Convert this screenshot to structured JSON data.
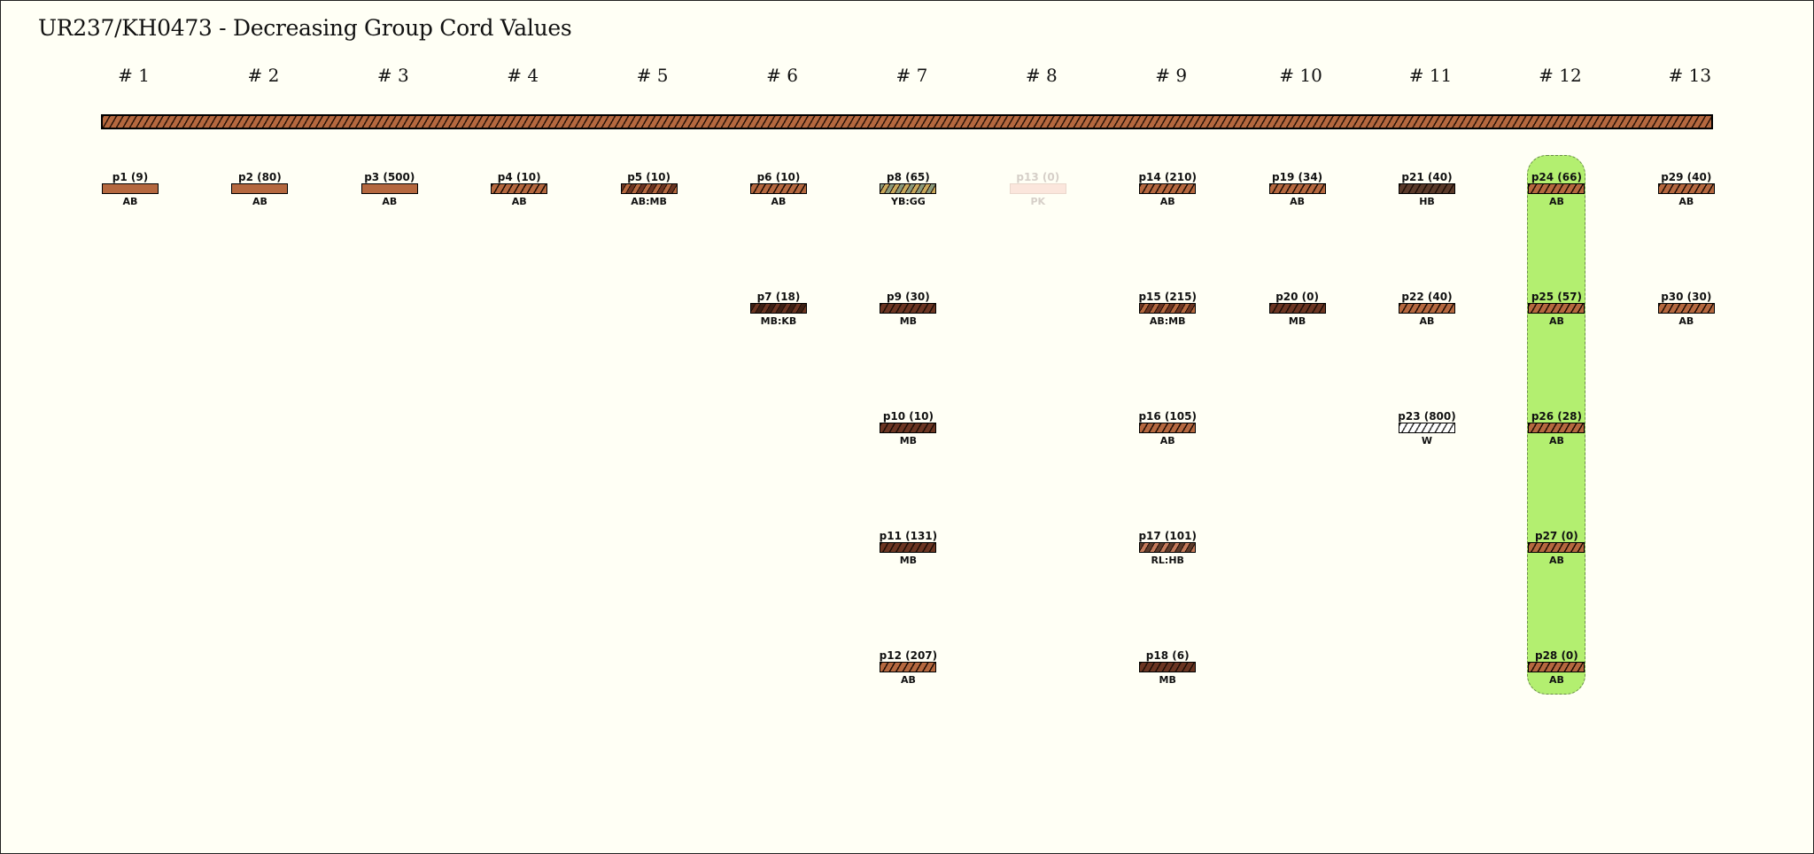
{
  "title": "UR237/KH0473 - Decreasing Group Cord Values",
  "groups": [
    "# 1",
    "# 2",
    "# 3",
    "# 4",
    "# 5",
    "# 6",
    "# 7",
    "# 8",
    "# 9",
    "# 10",
    "# 11",
    "# 12",
    "# 13"
  ],
  "colors": {
    "AB": "#b5683f",
    "MB": "#6b3522",
    "KB": "#3d2014",
    "YB": "#c9a85a",
    "GG": "#8a9a7a",
    "HB": "#5a3a2a",
    "RL": "#c47a5a",
    "W": "#ffffff",
    "PK": "#fbe6dc",
    "highlight": "#b3ef70",
    "background": "#fffff5"
  },
  "highlight_group": 12,
  "cords": [
    {
      "id": "p1",
      "label": "p1 (9)",
      "color": "AB",
      "group": 1,
      "row": 0,
      "style": "solid"
    },
    {
      "id": "p2",
      "label": "p2 (80)",
      "color": "AB",
      "group": 2,
      "row": 0,
      "style": "solid"
    },
    {
      "id": "p3",
      "label": "p3 (500)",
      "color": "AB",
      "group": 3,
      "row": 0,
      "style": "solid"
    },
    {
      "id": "p4",
      "label": "p4 (10)",
      "color": "AB",
      "group": 4,
      "row": 0,
      "style": "hatch"
    },
    {
      "id": "p5",
      "label": "p5 (10)",
      "color": "AB:MB",
      "group": 5,
      "row": 0,
      "style": "hatch"
    },
    {
      "id": "p6",
      "label": "p6 (10)",
      "color": "AB",
      "group": 6,
      "row": 0,
      "style": "hatch"
    },
    {
      "id": "p7",
      "label": "p7 (18)",
      "color": "MB:KB",
      "group": 6,
      "row": 1,
      "style": "hatch"
    },
    {
      "id": "p8",
      "label": "p8 (65)",
      "color": "YB:GG",
      "group": 7,
      "row": 0,
      "style": "hatch"
    },
    {
      "id": "p9",
      "label": "p9 (30)",
      "color": "MB",
      "group": 7,
      "row": 1,
      "style": "hatch"
    },
    {
      "id": "p10",
      "label": "p10 (10)",
      "color": "MB",
      "group": 7,
      "row": 2,
      "style": "hatch"
    },
    {
      "id": "p11",
      "label": "p11 (131)",
      "color": "MB",
      "group": 7,
      "row": 3,
      "style": "hatch"
    },
    {
      "id": "p12",
      "label": "p12 (207)",
      "color": "AB",
      "group": 7,
      "row": 4,
      "style": "hatch"
    },
    {
      "id": "p13",
      "label": "p13 (0)",
      "color": "PK",
      "group": 8,
      "row": 0,
      "style": "ghost"
    },
    {
      "id": "p14",
      "label": "p14 (210)",
      "color": "AB",
      "group": 9,
      "row": 0,
      "style": "hatch"
    },
    {
      "id": "p15",
      "label": "p15 (215)",
      "color": "AB:MB",
      "group": 9,
      "row": 1,
      "style": "hatch"
    },
    {
      "id": "p16",
      "label": "p16 (105)",
      "color": "AB",
      "group": 9,
      "row": 2,
      "style": "hatch"
    },
    {
      "id": "p17",
      "label": "p17 (101)",
      "color": "RL:HB",
      "group": 9,
      "row": 3,
      "style": "hatch"
    },
    {
      "id": "p18",
      "label": "p18 (6)",
      "color": "MB",
      "group": 9,
      "row": 4,
      "style": "hatch"
    },
    {
      "id": "p19",
      "label": "p19 (34)",
      "color": "AB",
      "group": 10,
      "row": 0,
      "style": "hatch"
    },
    {
      "id": "p20",
      "label": "p20 (0)",
      "color": "MB",
      "group": 10,
      "row": 1,
      "style": "hatch"
    },
    {
      "id": "p21",
      "label": "p21 (40)",
      "color": "HB",
      "group": 11,
      "row": 0,
      "style": "hatch"
    },
    {
      "id": "p22",
      "label": "p22 (40)",
      "color": "AB",
      "group": 11,
      "row": 1,
      "style": "hatch"
    },
    {
      "id": "p23",
      "label": "p23 (800)",
      "color": "W",
      "group": 11,
      "row": 2,
      "style": "hatch"
    },
    {
      "id": "p24",
      "label": "p24 (66)",
      "color": "AB",
      "group": 12,
      "row": 0,
      "style": "hatch"
    },
    {
      "id": "p25",
      "label": "p25 (57)",
      "color": "AB",
      "group": 12,
      "row": 1,
      "style": "hatch"
    },
    {
      "id": "p26",
      "label": "p26 (28)",
      "color": "AB",
      "group": 12,
      "row": 2,
      "style": "hatch"
    },
    {
      "id": "p27",
      "label": "p27 (0)",
      "color": "AB",
      "group": 12,
      "row": 3,
      "style": "hatch"
    },
    {
      "id": "p28",
      "label": "p28 (0)",
      "color": "AB",
      "group": 12,
      "row": 4,
      "style": "hatch"
    },
    {
      "id": "p29",
      "label": "p29 (40)",
      "color": "AB",
      "group": 13,
      "row": 0,
      "style": "hatch"
    },
    {
      "id": "p30",
      "label": "p30 (30)",
      "color": "AB",
      "group": 13,
      "row": 1,
      "style": "hatch"
    }
  ]
}
